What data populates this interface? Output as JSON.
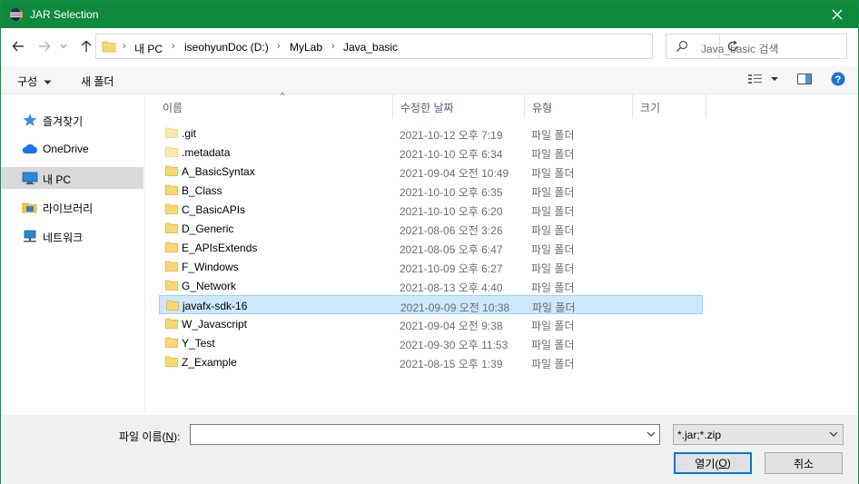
{
  "window": {
    "title": "JAR Selection",
    "accent": "#0f8a3c"
  },
  "address": {
    "crumbs": [
      "내 PC",
      "iseohyunDoc (D:)",
      "MyLab",
      "Java_basic"
    ]
  },
  "search": {
    "placeholder": "Java_basic 검색"
  },
  "toolbar": {
    "organize": "구성",
    "new_folder": "새 폴더"
  },
  "sidebar": {
    "items": [
      {
        "label": "즐겨찾기",
        "icon": "star-icon"
      },
      {
        "label": "OneDrive",
        "icon": "cloud-icon"
      },
      {
        "label": "내 PC",
        "icon": "computer-icon"
      },
      {
        "label": "라이브러리",
        "icon": "library-icon"
      },
      {
        "label": "네트워크",
        "icon": "network-icon"
      }
    ],
    "selected": "내 PC"
  },
  "columns": {
    "name": "이름",
    "date": "수정한 날짜",
    "type": "유형",
    "size": "크기"
  },
  "files": [
    {
      "name": ".git",
      "date": "2021-10-12 오후 7:19",
      "type": "파일 폴더"
    },
    {
      "name": ".metadata",
      "date": "2021-10-10 오후 6:34",
      "type": "파일 폴더"
    },
    {
      "name": "A_BasicSyntax",
      "date": "2021-09-04 오전 10:49",
      "type": "파일 폴더"
    },
    {
      "name": "B_Class",
      "date": "2021-10-10 오후 6:35",
      "type": "파일 폴더"
    },
    {
      "name": "C_BasicAPIs",
      "date": "2021-10-10 오후 6:20",
      "type": "파일 폴더"
    },
    {
      "name": "D_Generic",
      "date": "2021-08-06 오전 3:26",
      "type": "파일 폴더"
    },
    {
      "name": "E_APIsExtends",
      "date": "2021-08-05 오후 6:47",
      "type": "파일 폴더"
    },
    {
      "name": "F_Windows",
      "date": "2021-10-09 오후 6:27",
      "type": "파일 폴더"
    },
    {
      "name": "G_Network",
      "date": "2021-08-13 오후 4:40",
      "type": "파일 폴더"
    },
    {
      "name": "javafx-sdk-16",
      "date": "2021-09-09 오전 10:38",
      "type": "파일 폴더"
    },
    {
      "name": "W_Javascript",
      "date": "2021-09-04 오전 9:38",
      "type": "파일 폴더"
    },
    {
      "name": "Y_Test",
      "date": "2021-09-30 오후 11:53",
      "type": "파일 폴더"
    },
    {
      "name": "Z_Example",
      "date": "2021-08-15 오후 1:39",
      "type": "파일 폴더"
    }
  ],
  "selected_file": "javafx-sdk-16",
  "bottom": {
    "filename_label_prefix": "파일 이름(",
    "filename_label_key": "N",
    "filename_label_suffix": "):",
    "filename_value": "",
    "filter_value": "*.jar;*.zip",
    "open_label_prefix": "열기(",
    "open_label_key": "O",
    "open_label_suffix": ")",
    "cancel_label": "취소"
  }
}
